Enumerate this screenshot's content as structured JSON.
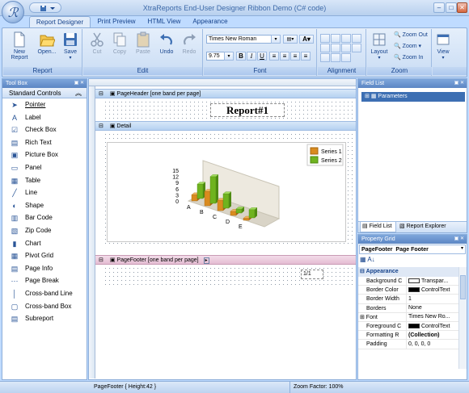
{
  "window": {
    "title": "XtraReports End-User Designer Ribbon Demo (C# code)",
    "controls": {
      "minimize": "–",
      "maximize": "□",
      "close": "✕"
    }
  },
  "tabs": [
    "Report Designer",
    "Print Preview",
    "HTML View",
    "Appearance"
  ],
  "ribbon": {
    "groups": {
      "report": "Report",
      "edit": "Edit",
      "font": "Font",
      "alignment": "Alignment",
      "layout": "Layout",
      "zoom": "Zoom",
      "view": "View"
    },
    "buttons": {
      "new_report": "New Report",
      "open": "Open...",
      "save": "Save",
      "cut": "Cut",
      "copy": "Copy",
      "paste": "Paste",
      "undo": "Undo",
      "redo": "Redo",
      "layout": "Layout",
      "zoom_out": "Zoom Out",
      "zoom": "Zoom",
      "zoom_in": "Zoom In",
      "view": "View"
    },
    "font_name": "Times New Roman",
    "font_size": "9.75",
    "format_buttons": [
      "B",
      "I",
      "U"
    ]
  },
  "toolbox": {
    "title": "Tool Box",
    "category": "Standard Controls",
    "items": [
      {
        "label": "Pointer",
        "icon": "pointer-icon"
      },
      {
        "label": "Label",
        "icon": "label-icon"
      },
      {
        "label": "Check Box",
        "icon": "checkbox-icon"
      },
      {
        "label": "Rich Text",
        "icon": "richtext-icon"
      },
      {
        "label": "Picture Box",
        "icon": "picture-icon"
      },
      {
        "label": "Panel",
        "icon": "panel-icon"
      },
      {
        "label": "Table",
        "icon": "table-icon"
      },
      {
        "label": "Line",
        "icon": "line-icon"
      },
      {
        "label": "Shape",
        "icon": "shape-icon"
      },
      {
        "label": "Bar Code",
        "icon": "barcode-icon"
      },
      {
        "label": "Zip Code",
        "icon": "zipcode-icon"
      },
      {
        "label": "Chart",
        "icon": "chart-icon"
      },
      {
        "label": "Pivot Grid",
        "icon": "pivotgrid-icon"
      },
      {
        "label": "Page Info",
        "icon": "pageinfo-icon"
      },
      {
        "label": "Page Break",
        "icon": "pagebreak-icon"
      },
      {
        "label": "Cross-band Line",
        "icon": "crossband-line-icon"
      },
      {
        "label": "Cross-band Box",
        "icon": "crossband-box-icon"
      },
      {
        "label": "Subreport",
        "icon": "subreport-icon"
      }
    ]
  },
  "design": {
    "page_header": "PageHeader [one band per page]",
    "report_title": "Report#1",
    "detail": "Detail",
    "page_footer": "PageFooter [one band per page]",
    "page_number": "1/1"
  },
  "chart_data": {
    "type": "bar",
    "categories": [
      "A",
      "B",
      "C",
      "D",
      "E"
    ],
    "series": [
      {
        "name": "Series 1",
        "values": [
          3,
          7,
          5,
          2,
          1
        ],
        "color": "#d98b1f"
      },
      {
        "name": "Series 2",
        "values": [
          7,
          13,
          7,
          2,
          4
        ],
        "color": "#6fb31f"
      }
    ],
    "yticks": [
      "15",
      "12",
      "9",
      "6",
      "3",
      "0"
    ],
    "ylim": [
      0,
      15
    ]
  },
  "field_list": {
    "title": "Field List",
    "root": "Parameters",
    "tabs": [
      "Field List",
      "Report Explorer"
    ]
  },
  "property_grid": {
    "title": "Property Grid",
    "selected_object": "PageFooter  Page Footer",
    "category": "Appearance",
    "rows": [
      {
        "name": "Background C",
        "value": "Transpar..."
      },
      {
        "name": "Border Color",
        "value": "ControlText"
      },
      {
        "name": "Border Width",
        "value": "1"
      },
      {
        "name": "Borders",
        "value": "None"
      },
      {
        "name": "Font",
        "value": "Times New Ro..."
      },
      {
        "name": "Foreground C",
        "value": "ControlText"
      },
      {
        "name": "Formatting R",
        "value": "(Collection)"
      },
      {
        "name": "Padding",
        "value": "0, 0, 0, 0"
      }
    ]
  },
  "status": {
    "left": "PageFooter { Height:42 }",
    "right": "Zoom Factor: 100%"
  }
}
